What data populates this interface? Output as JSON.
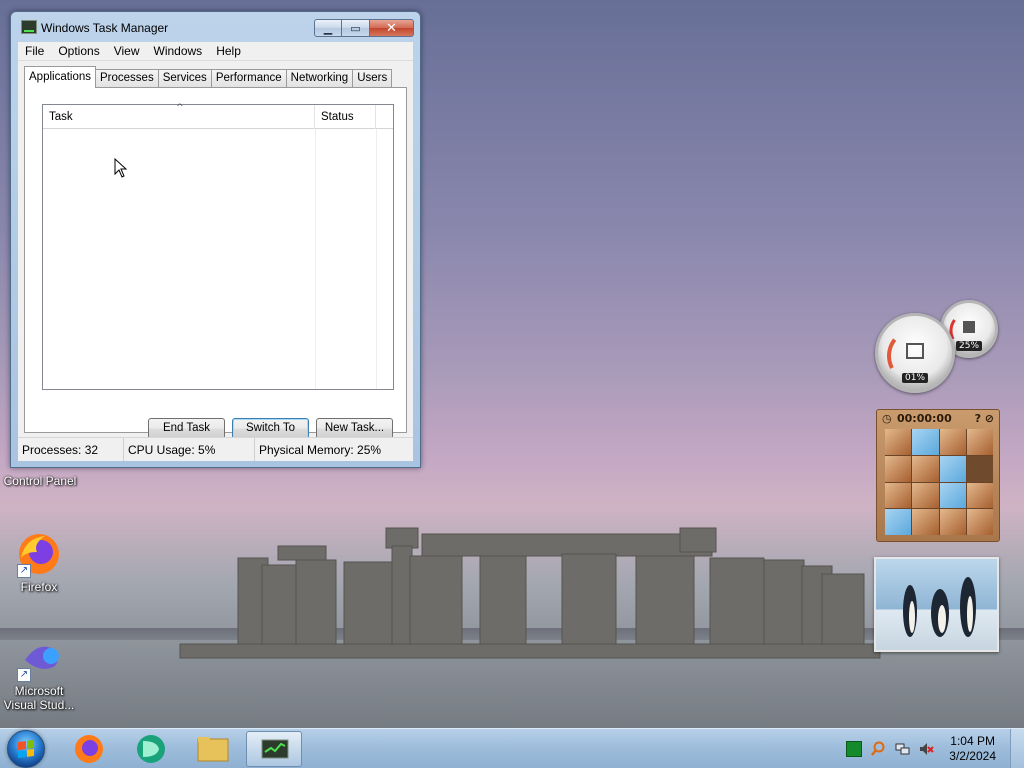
{
  "window": {
    "title": "Windows Task Manager",
    "menu": [
      "File",
      "Options",
      "View",
      "Windows",
      "Help"
    ],
    "tabs": [
      "Applications",
      "Processes",
      "Services",
      "Performance",
      "Networking",
      "Users"
    ],
    "active_tab": "Applications",
    "columns": {
      "task": "Task",
      "status": "Status"
    },
    "buttons": {
      "end_task": "End Task",
      "switch_to": "Switch To",
      "new_task": "New Task..."
    },
    "status": {
      "processes": "Processes: 32",
      "cpu": "CPU Usage: 5%",
      "memory": "Physical Memory: 25%"
    }
  },
  "desktop_icons": {
    "control_panel": "Control Panel",
    "firefox": "Firefox",
    "vs_line1": "Microsoft",
    "vs_line2": "Visual Stud..."
  },
  "gadgets": {
    "cpu_readout": "01%",
    "mem_readout": "25%",
    "puzzle_timer": "00:00:00"
  },
  "taskbar": {
    "time": "1:04 PM",
    "date": "3/2/2024"
  },
  "colors": {
    "accent": "#3c7fb1",
    "titlebar": "#bcd3ea",
    "taskbar": "#9fbedc"
  }
}
